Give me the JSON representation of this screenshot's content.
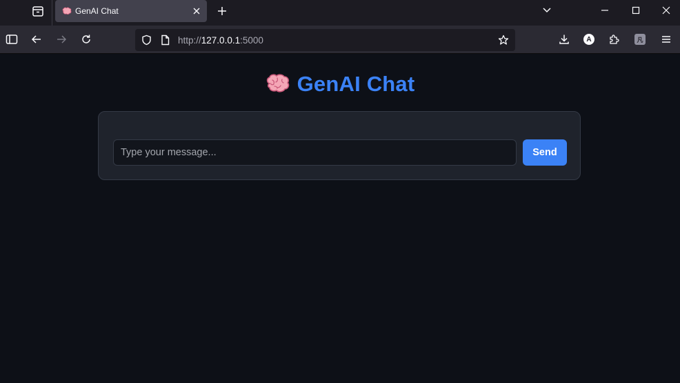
{
  "browser": {
    "tab": {
      "title": "GenAI Chat",
      "favicon": "brain-emoji"
    },
    "url": {
      "scheme": "http://",
      "host": "127.0.0.1",
      "port": ":5000"
    }
  },
  "page": {
    "title_icon": "brain-emoji",
    "title": "GenAI Chat",
    "chat": {
      "input_placeholder": "Type your message...",
      "input_value": "",
      "send_label": "Send"
    }
  },
  "colors": {
    "accent": "#3b82f6",
    "page_bg": "#0d1017",
    "card_bg": "#1f232c"
  }
}
